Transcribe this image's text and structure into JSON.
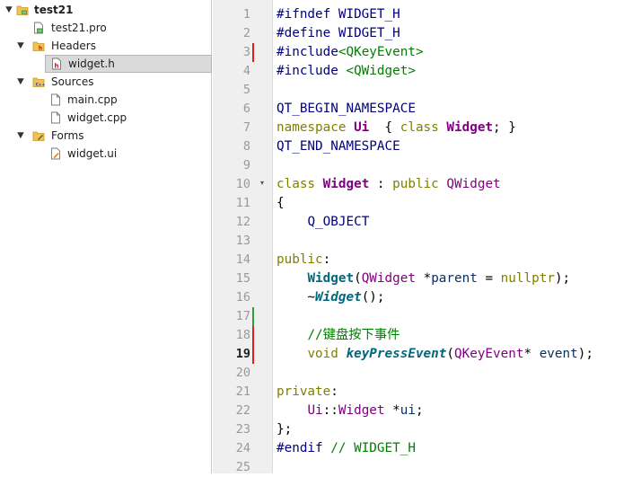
{
  "project_tree": [
    {
      "label": "test21",
      "icon": "project-icon",
      "arrow": "expanded",
      "bold": true
    },
    {
      "label": "test21.pro",
      "icon": "pro-file-icon"
    },
    {
      "label": "Headers",
      "icon": "headers-folder-icon",
      "arrow": "expanded"
    },
    {
      "label": "widget.h",
      "icon": "header-file-icon",
      "selected": true
    },
    {
      "label": "Sources",
      "icon": "sources-folder-icon",
      "arrow": "expanded"
    },
    {
      "label": "main.cpp",
      "icon": "cpp-file-icon"
    },
    {
      "label": "widget.cpp",
      "icon": "cpp-file-icon"
    },
    {
      "label": "Forms",
      "icon": "forms-folder-icon",
      "arrow": "expanded"
    },
    {
      "label": "widget.ui",
      "icon": "ui-file-icon"
    }
  ],
  "editor": {
    "current_line": 19,
    "line_numbers": [
      "1",
      "2",
      "3",
      "4",
      "5",
      "6",
      "7",
      "8",
      "9",
      "10",
      "11",
      "12",
      "13",
      "14",
      "15",
      "16",
      "17",
      "18",
      "19",
      "20",
      "21",
      "22",
      "23",
      "24",
      "25"
    ],
    "lines": [
      [
        [
          "pp",
          "#ifndef WIDGET_H"
        ]
      ],
      [
        [
          "pp",
          "#define WIDGET_H"
        ]
      ],
      [
        [
          "pp",
          "#include"
        ],
        [
          "str",
          "<QKeyEvent>"
        ]
      ],
      [
        [
          "pp",
          "#include "
        ],
        [
          "str",
          "<QWidget>"
        ]
      ],
      [],
      [
        [
          "mc",
          "QT_BEGIN_NAMESPACE"
        ]
      ],
      [
        [
          "kw",
          "namespace "
        ],
        [
          "tyb",
          "Ui"
        ],
        [
          "",
          "  { "
        ],
        [
          "kw",
          "class "
        ],
        [
          "tyb",
          "Widget"
        ],
        [
          "",
          "; }"
        ]
      ],
      [
        [
          "mc",
          "QT_END_NAMESPACE"
        ]
      ],
      [],
      [
        [
          "kw",
          "class "
        ],
        [
          "tyb",
          "Widget"
        ],
        [
          "",
          " : "
        ],
        [
          "kw",
          "public "
        ],
        [
          "ty",
          "QWidget"
        ]
      ],
      [
        [
          "",
          "{"
        ]
      ],
      [
        [
          "",
          "    "
        ],
        [
          "mc",
          "Q_OBJECT"
        ]
      ],
      [],
      [
        [
          "kw",
          "public"
        ],
        [
          "",
          ":"
        ]
      ],
      [
        [
          "",
          "    "
        ],
        [
          "fn",
          "Widget"
        ],
        [
          "",
          "("
        ],
        [
          "ty",
          "QWidget"
        ],
        [
          "",
          " *"
        ],
        [
          "var",
          "parent"
        ],
        [
          "",
          " = "
        ],
        [
          "kw",
          "nullptr"
        ],
        [
          "",
          ");"
        ]
      ],
      [
        [
          "",
          "    ~"
        ],
        [
          "fni",
          "Widget"
        ],
        [
          "",
          "();"
        ]
      ],
      [],
      [
        [
          "",
          "    "
        ],
        [
          "cm",
          "//键盘按下事件"
        ]
      ],
      [
        [
          "",
          "    "
        ],
        [
          "kw",
          "void "
        ],
        [
          "fni",
          "keyPressEvent"
        ],
        [
          "",
          "("
        ],
        [
          "ty",
          "QKeyEvent"
        ],
        [
          "",
          "* "
        ],
        [
          "var",
          "event"
        ],
        [
          "",
          ");"
        ]
      ],
      [],
      [
        [
          "kw",
          "private"
        ],
        [
          "",
          ":"
        ]
      ],
      [
        [
          "",
          "    "
        ],
        [
          "ty",
          "Ui"
        ],
        [
          "",
          "::"
        ],
        [
          "ty",
          "Widget"
        ],
        [
          "",
          " *"
        ],
        [
          "var",
          "ui"
        ],
        [
          "",
          ";"
        ]
      ],
      [
        [
          "",
          "};"
        ]
      ],
      [
        [
          "pp",
          "#endif "
        ],
        [
          "cm",
          "// WIDGET_H"
        ]
      ],
      []
    ],
    "change_marks": [
      {
        "line": 3,
        "color": "#e0201b"
      },
      {
        "line": 17,
        "color": "#2ea043"
      },
      {
        "line": 18,
        "color": "#e0201b"
      },
      {
        "line": 19,
        "color": "#e0201b"
      }
    ],
    "fold_markers": [
      {
        "line": 10,
        "glyph": "▾"
      }
    ]
  }
}
